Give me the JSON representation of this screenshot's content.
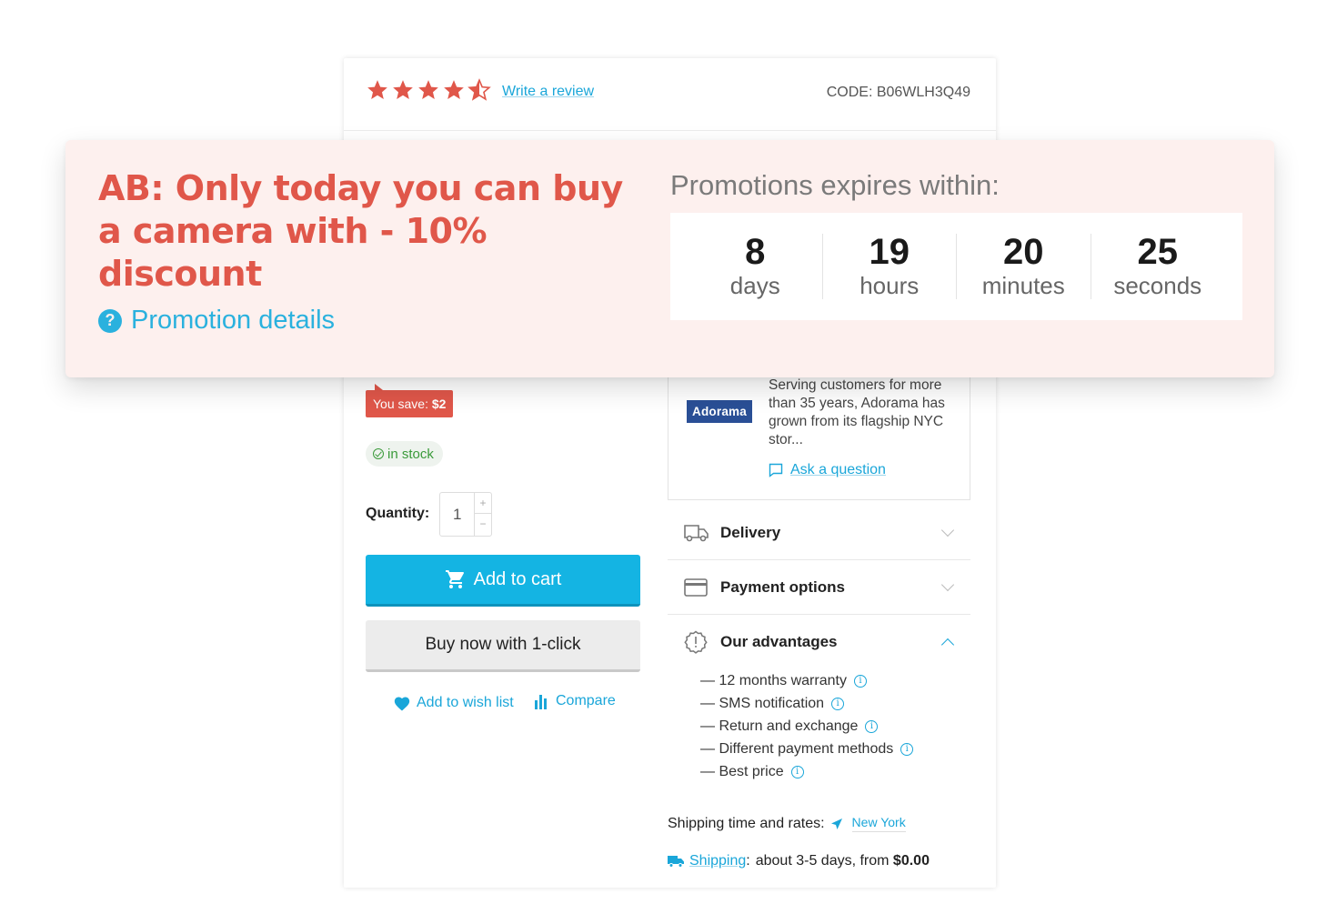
{
  "product": {
    "rating": 4.5,
    "write_review": "Write a review",
    "code": "CODE:  B06WLH3Q49",
    "you_save_label": "You save: ",
    "you_save_value": "$2",
    "stock": "in stock",
    "quantity_label": "Quantity:",
    "quantity_value": "1",
    "add_to_cart": "Add to cart",
    "buy_one_click": "Buy now with 1-click",
    "wish_list": "Add to wish list",
    "compare": "Compare"
  },
  "seller": {
    "logo": "Adorama",
    "description": "Serving customers for more than 35 years, Adorama has grown from its flagship NYC stor...",
    "ask_question": "Ask a question"
  },
  "accordion": [
    {
      "title": "Delivery",
      "icon": "truck-icon",
      "expanded": false
    },
    {
      "title": "Payment options",
      "icon": "card-icon",
      "expanded": false
    },
    {
      "title": "Our advantages",
      "icon": "badge-icon",
      "expanded": true
    }
  ],
  "advantages": [
    "— 12 months warranty",
    "— SMS notification",
    "— Return and exchange",
    "— Different payment methods",
    "— Best price"
  ],
  "shipping": {
    "rates_label": "Shipping time and rates:",
    "city": "New York",
    "link": "Shipping",
    "separator": ":",
    "details": "about 3-5 days, from ",
    "price": "$0.00"
  },
  "promo": {
    "title": "AB: Only today you can buy a camera with - 10% discount",
    "details_link": "Promotion details",
    "expires_label": "Promotions expires within:",
    "timer": [
      {
        "value": "8",
        "unit": "days"
      },
      {
        "value": "19",
        "unit": "hours"
      },
      {
        "value": "20",
        "unit": "minutes"
      },
      {
        "value": "25",
        "unit": "seconds"
      }
    ]
  },
  "colors": {
    "accent": "#14b4e3",
    "promo_red": "#e0574a",
    "promo_bg": "#fdf0ee",
    "star": "#e0574a"
  }
}
